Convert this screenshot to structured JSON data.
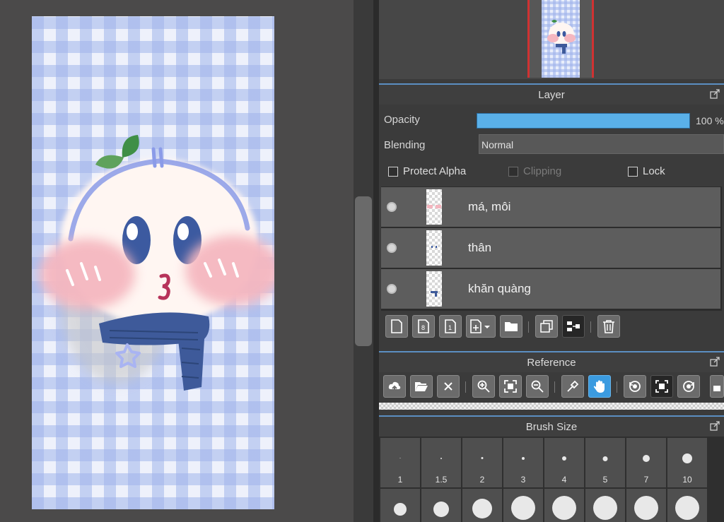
{
  "layer_panel": {
    "title": "Layer",
    "opacity_label": "Opacity",
    "opacity_value": "100 %",
    "opacity_fraction": 1.0,
    "blending_label": "Blending",
    "blending_value": "Normal",
    "protect_alpha": "Protect Alpha",
    "clipping": "Clipping",
    "lock": "Lock",
    "layers": [
      {
        "name": "má, môi"
      },
      {
        "name": "thân"
      },
      {
        "name": "khăn quàng"
      }
    ]
  },
  "reference_panel": {
    "title": "Reference"
  },
  "brush_panel": {
    "title": "Brush Size",
    "sizes": [
      "1",
      "1.5",
      "2",
      "3",
      "4",
      "5",
      "7",
      "10"
    ]
  },
  "colors": {
    "accent": "#5b8fc2",
    "opacity_bar": "#5ab0e8",
    "active_tool": "#3b9be0",
    "navigator_frame": "#d03232"
  }
}
